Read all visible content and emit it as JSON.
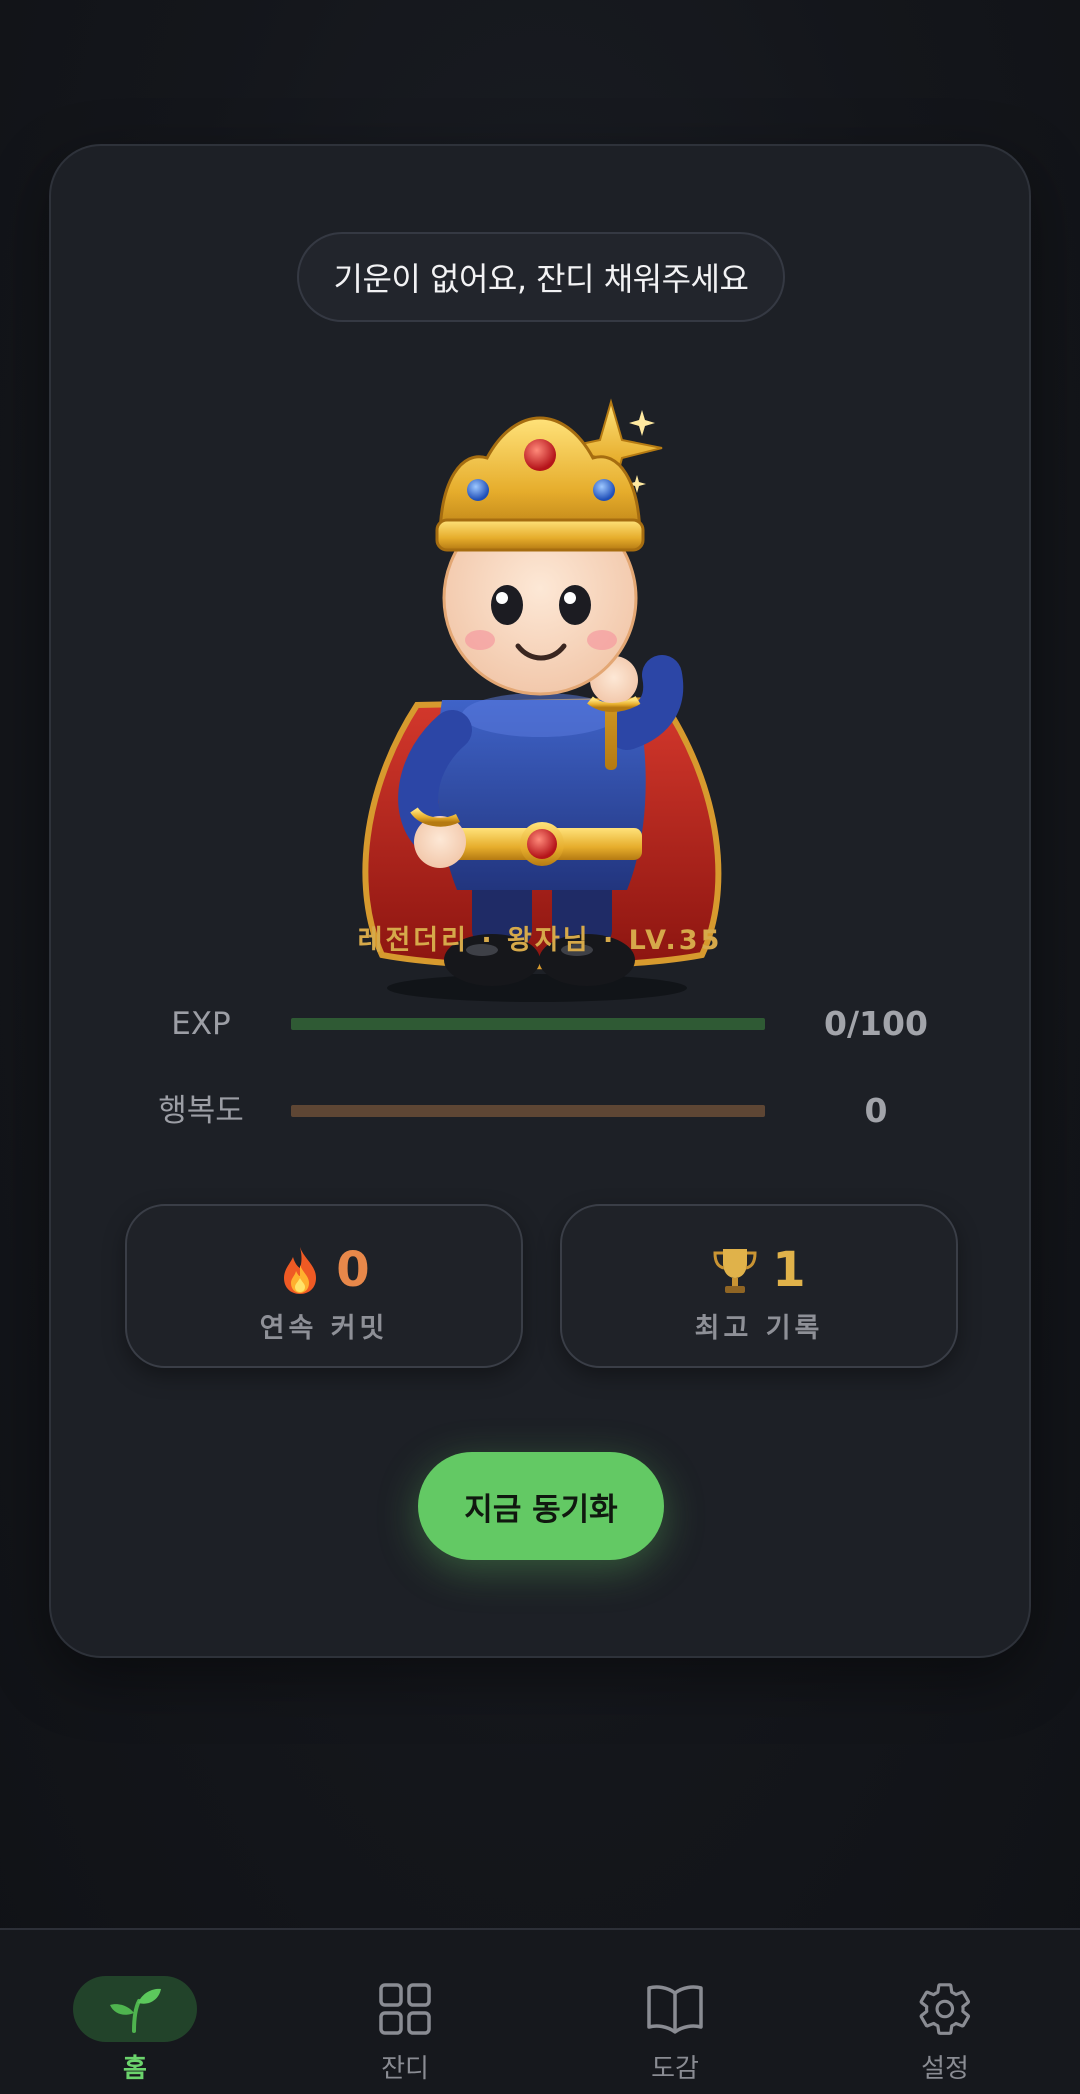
{
  "status_message": "기운이 없어요, 잔디 채워주세요",
  "character": {
    "title_line": "레전더리 · 왕자님 · LV.35"
  },
  "stats": {
    "exp": {
      "label": "EXP",
      "value_text": "0/100",
      "fraction": 0.0,
      "bar_color": "#2f5a34"
    },
    "happiness": {
      "label": "행복도",
      "value_text": "0",
      "fraction": 0.0,
      "bar_color": "#5e4634"
    }
  },
  "streak": {
    "current": {
      "icon": "fire-icon",
      "value": "0",
      "label": "연속 커밋",
      "color": "#e8884a"
    },
    "best": {
      "icon": "trophy-icon",
      "value": "1",
      "label": "최고 기록",
      "color": "#e0b24a"
    }
  },
  "sync_button": {
    "label": "지금 동기화"
  },
  "nav": {
    "items": [
      {
        "label": "홈",
        "icon": "sprout-icon",
        "active": true
      },
      {
        "label": "잔디",
        "icon": "grid-icon",
        "active": false
      },
      {
        "label": "도감",
        "icon": "book-icon",
        "active": false
      },
      {
        "label": "설정",
        "icon": "gear-icon",
        "active": false
      }
    ]
  },
  "colors": {
    "accent_green": "#63c964",
    "gold": "#d6a94a",
    "background": "#121419",
    "card": "#1d2026"
  }
}
